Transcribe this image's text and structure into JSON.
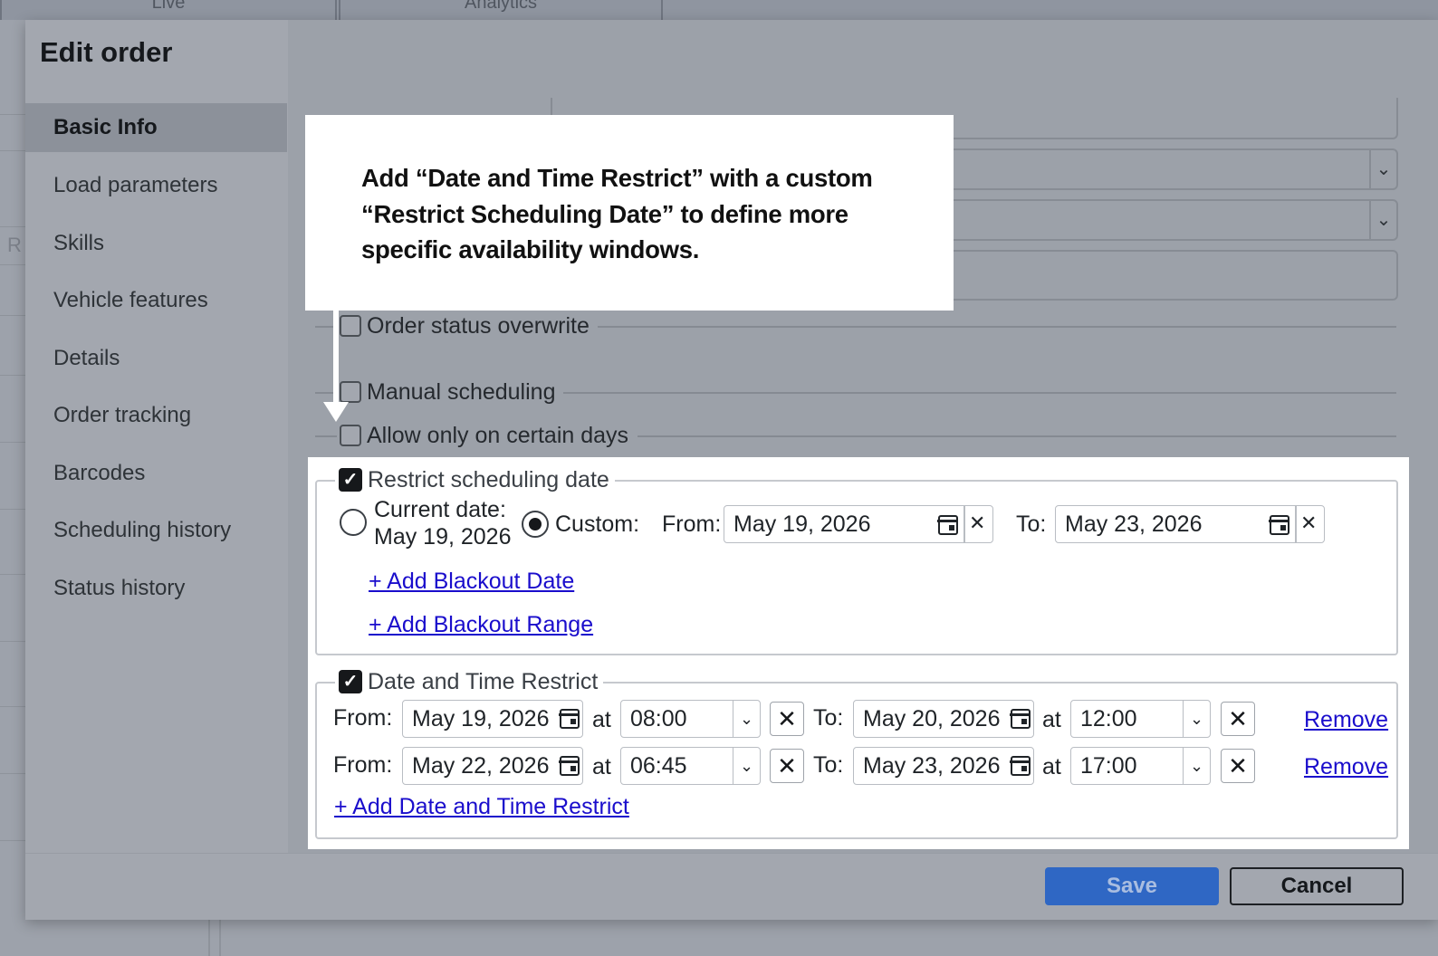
{
  "background_app": {
    "tabs": [
      "Live",
      "Analytics"
    ],
    "side_fragment": "R"
  },
  "modal": {
    "title": "Edit order",
    "nav": [
      {
        "label": "Basic Info",
        "active": true
      },
      {
        "label": "Load parameters",
        "active": false
      },
      {
        "label": "Skills",
        "active": false
      },
      {
        "label": "Vehicle features",
        "active": false
      },
      {
        "label": "Details",
        "active": false
      },
      {
        "label": "Order tracking",
        "active": false
      },
      {
        "label": "Barcodes",
        "active": false
      },
      {
        "label": "Scheduling history",
        "active": false
      },
      {
        "label": "Status history",
        "active": false
      }
    ],
    "options": {
      "order_status_overwrite": {
        "label": "Order status overwrite",
        "checked": false
      },
      "manual_scheduling": {
        "label": "Manual scheduling",
        "checked": false
      },
      "allow_certain_days": {
        "label": "Allow only on certain days",
        "checked": false
      }
    },
    "restrict_scheduling": {
      "label": "Restrict scheduling date",
      "checked": true,
      "current_date_label": "Current date:",
      "current_date_value": "May 19, 2026",
      "custom_label": "Custom:",
      "selected": "custom",
      "from_label": "From:",
      "from_value": "May 19, 2026",
      "to_label": "To:",
      "to_value": "May 23, 2026",
      "clear_symbol": "✕",
      "add_blackout_date": "+ Add Blackout Date",
      "add_blackout_range": "+ Add Blackout Range"
    },
    "date_time_restrict": {
      "label": "Date and Time Restrict",
      "checked": true,
      "from_label": "From:",
      "at_label": "at",
      "to_label": "To:",
      "remove_label": "Remove",
      "x_symbol": "✕",
      "rows": [
        {
          "from_date": "May 19, 2026",
          "from_time": "08:00",
          "to_date": "May 20, 2026",
          "to_time": "12:00"
        },
        {
          "from_date": "May 22, 2026",
          "from_time": "06:45",
          "to_date": "May 23, 2026",
          "to_time": "17:00"
        }
      ],
      "add_link": "+ Add Date and Time Restrict"
    },
    "footer": {
      "save_label": "Save",
      "cancel_label": "Cancel"
    }
  },
  "callout": {
    "text": "Add “Date and Time Restrict” with a custom “Restrict Scheduling Date” to define more specific availability windows."
  },
  "colors": {
    "overlay": "#9da2ab",
    "link": "#1a0dcc",
    "save_button": "#2f67c4",
    "checkbox_checked": "#16181b"
  }
}
